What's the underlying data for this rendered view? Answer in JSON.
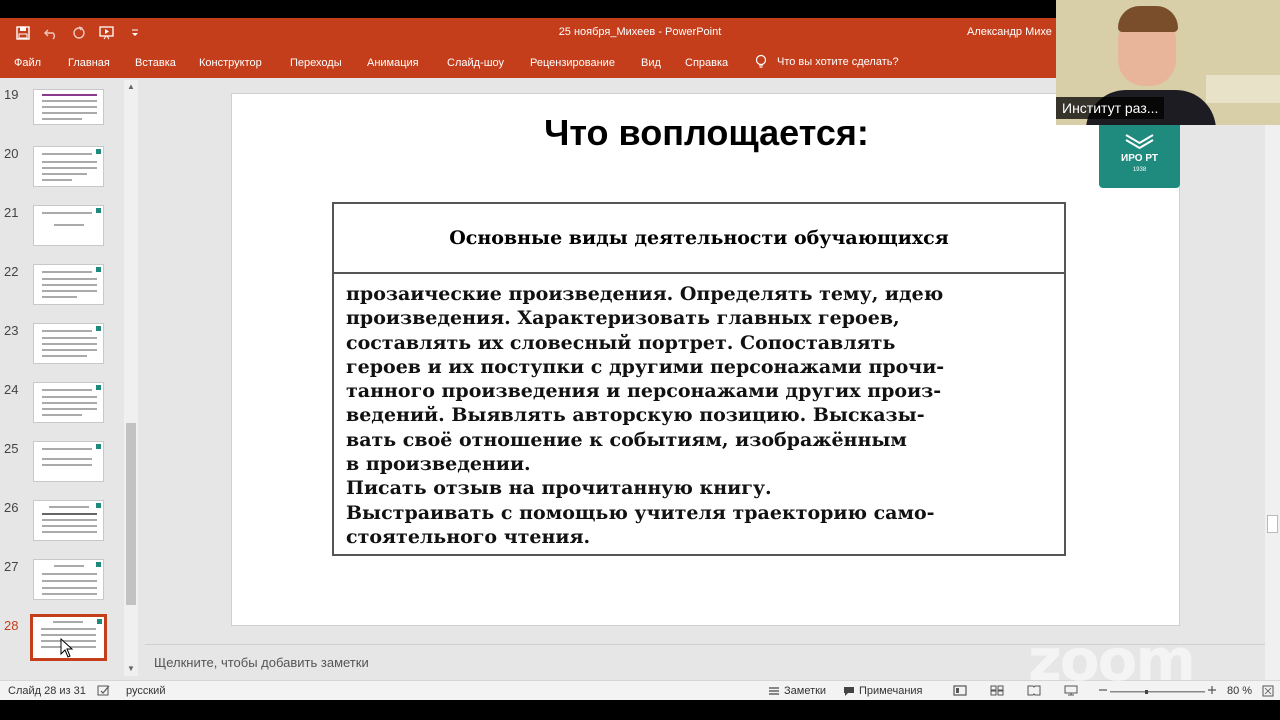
{
  "window": {
    "doc_title": "25 ноября_Михеев - PowerPoint",
    "user": "Александр Михе"
  },
  "ribbon": {
    "tabs": [
      "Файл",
      "Главная",
      "Вставка",
      "Конструктор",
      "Переходы",
      "Анимация",
      "Слайд-шоу",
      "Рецензирование",
      "Вид",
      "Справка"
    ],
    "tell_me": "Что вы хотите сделать?"
  },
  "thumbnails": {
    "numbers": [
      "19",
      "20",
      "21",
      "22",
      "23",
      "24",
      "25",
      "26",
      "27",
      "28"
    ],
    "active": "28"
  },
  "slide": {
    "title": "Что воплощается:",
    "table_header": "Основные виды деятельности обучающихся",
    "body_lines": [
      "прозаические произведения. Определять тему, идею",
      "произведения. Характеризовать главных героев,",
      "составлять их словесный портрет. Сопоставлять",
      "героев и их поступки с другими персонажами прочи-",
      "танного произведения и персонажами других произ-",
      "ведений. Выявлять авторскую позицию. Высказы-",
      "вать своё отношение к событиям, изображённым",
      "в произведении.",
      "Писать отзыв на прочитанную книгу.",
      "Выстраивать с помощью учителя траекторию само-",
      "стоятельного чтения."
    ]
  },
  "notes": {
    "placeholder": "Щелкните, чтобы добавить заметки"
  },
  "status": {
    "slide_counter": "Слайд 28 из 31",
    "language": "русский",
    "notes_btn": "Заметки",
    "comments_btn": "Примечания",
    "zoom_level": "80 %"
  },
  "video": {
    "participant_name": "Институт раз..."
  },
  "logo": {
    "text": "ИРО РТ",
    "year": "1938"
  },
  "watermark": "zoom"
}
